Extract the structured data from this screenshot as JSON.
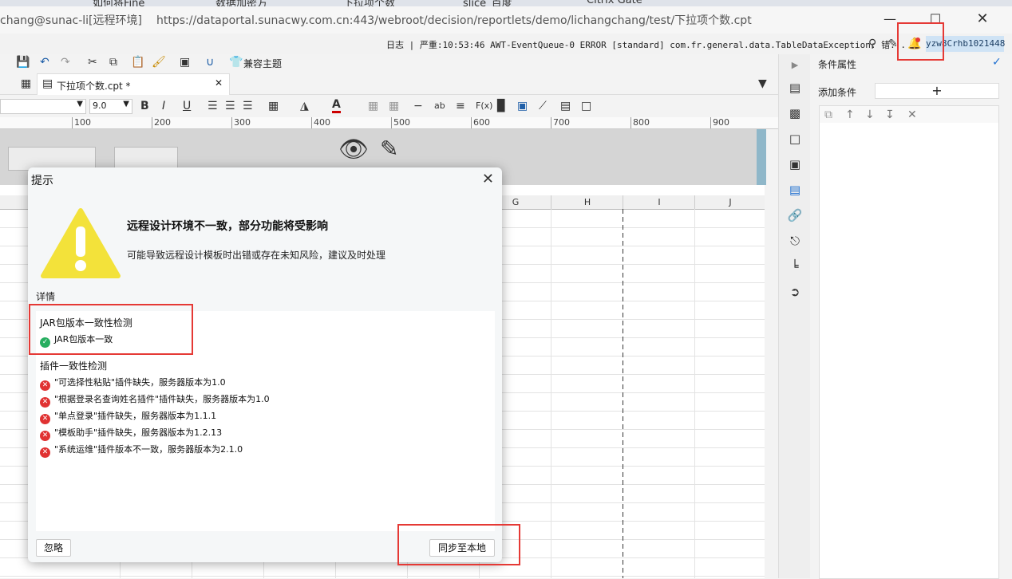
{
  "browser_tabs": [
    "如何将Fine",
    "数据加密方",
    "下拉项个数",
    "slice_百度",
    "Citrix Gate"
  ],
  "window": {
    "title": "chang@sunac-li[远程环境]",
    "url": "https://dataportal.sunacwy.com.cn:443/webroot/decision/reportlets/demo/lichangchang/test/下拉项个数.cpt"
  },
  "log": {
    "text": "日志 | 严重:10:53:46 AWT-EventQueue-0 ERROR [standard] com.fr.general.data.TableDataException: 错..."
  },
  "user_badge": "yzw8Crhb1021448",
  "toolbar": {
    "theme_label": "兼容主题"
  },
  "file_tab": {
    "name": "下拉项个数.cpt *"
  },
  "format": {
    "font_size": "9.0"
  },
  "ruler": [
    "100",
    "200",
    "300",
    "400",
    "500",
    "600",
    "700",
    "800",
    "900"
  ],
  "grid": {
    "columns": [
      "G",
      "H",
      "I",
      "J"
    ]
  },
  "right_panel": {
    "title": "条件属性",
    "add_condition_label": "添加条件",
    "add_icon": "+"
  },
  "dialog": {
    "title": "提示",
    "heading": "远程设计环境不一致，部分功能将受影响",
    "description": "可能导致远程设计模板时出错或存在未知风险，建议及时处理",
    "details_label": "详情",
    "jar_section": {
      "title": "JAR包版本一致性检测",
      "result": "JAR包版本一致"
    },
    "plugin_section": {
      "title": "插件一致性检测",
      "items": [
        "\"可选择性粘贴\"插件缺失，服务器版本为1.0",
        "\"根据登录名查询姓名插件\"插件缺失，服务器版本为1.0",
        "\"单点登录\"插件缺失，服务器版本为1.1.1",
        "\"模板助手\"插件缺失，服务器版本为1.2.13",
        "\"系统运维\"插件版本不一致，服务器版本为2.1.0"
      ]
    },
    "ignore_button": "忽略",
    "sync_button": "同步至本地"
  },
  "colors": {
    "highlight": "#e53935",
    "warning": "#f3e23a",
    "ok": "#27ae60",
    "error": "#e03232"
  }
}
